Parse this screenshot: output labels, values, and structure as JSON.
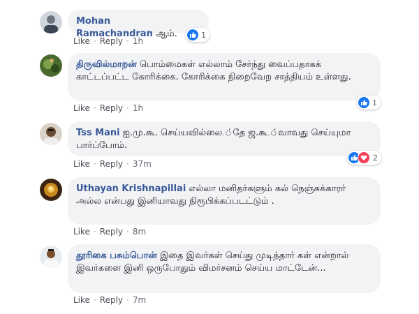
{
  "comments": [
    {
      "author": "Mohan Ramachandran",
      "text": "ஆம்.",
      "like": "Like",
      "reply": "Reply",
      "time": "1h",
      "reactions": "1",
      "reaction_types": [
        "like"
      ]
    },
    {
      "author": "திருவில்மாறன்",
      "text": "பொம்மைகள் எல்லாம் சேர்ந்து வைப்பதாகக் காட்டப்பட்ட கோரிக்கை. கோரிக்கை நிறைவேற சாத்தியம் உள்ளது.",
      "like": "Like",
      "reply": "Reply",
      "time": "1h",
      "reactions": "1",
      "reaction_types": [
        "like"
      ]
    },
    {
      "author": "Tss Mani",
      "text": "ஐ.மு.கூ. செய்யவில்லை.்தே ஜ.கூ.்வாவது செய்யுமா பார்ப்போம்.",
      "like": "Like",
      "reply": "Reply",
      "time": "37m",
      "reactions": "2",
      "reaction_types": [
        "like",
        "love"
      ]
    },
    {
      "author": "Uthayan Krishnapillai",
      "text": "எல்லா மனிதர்களும் கல் நெஞ்சுக்காரர் அல்ல என்பது இனியாவது நிரூபிக்கப்படட்டும் .",
      "like": "Like",
      "reply": "Reply",
      "time": "8m"
    },
    {
      "author": "தூரிகை பசும்பொன்",
      "text": "இதை இவர்கள் செய்து முடித்தார் கள் என்றால் இவர்களை இனி ஒருபோதும் விமர்சனம் செய்ய மாட்டேன்...",
      "like": "Like",
      "reply": "Reply",
      "time": "7m"
    }
  ],
  "colors": {
    "author": "#385898",
    "bubble": "#f2f3f5",
    "like_reaction": "#1877f2",
    "love_reaction": "#f33e58"
  }
}
